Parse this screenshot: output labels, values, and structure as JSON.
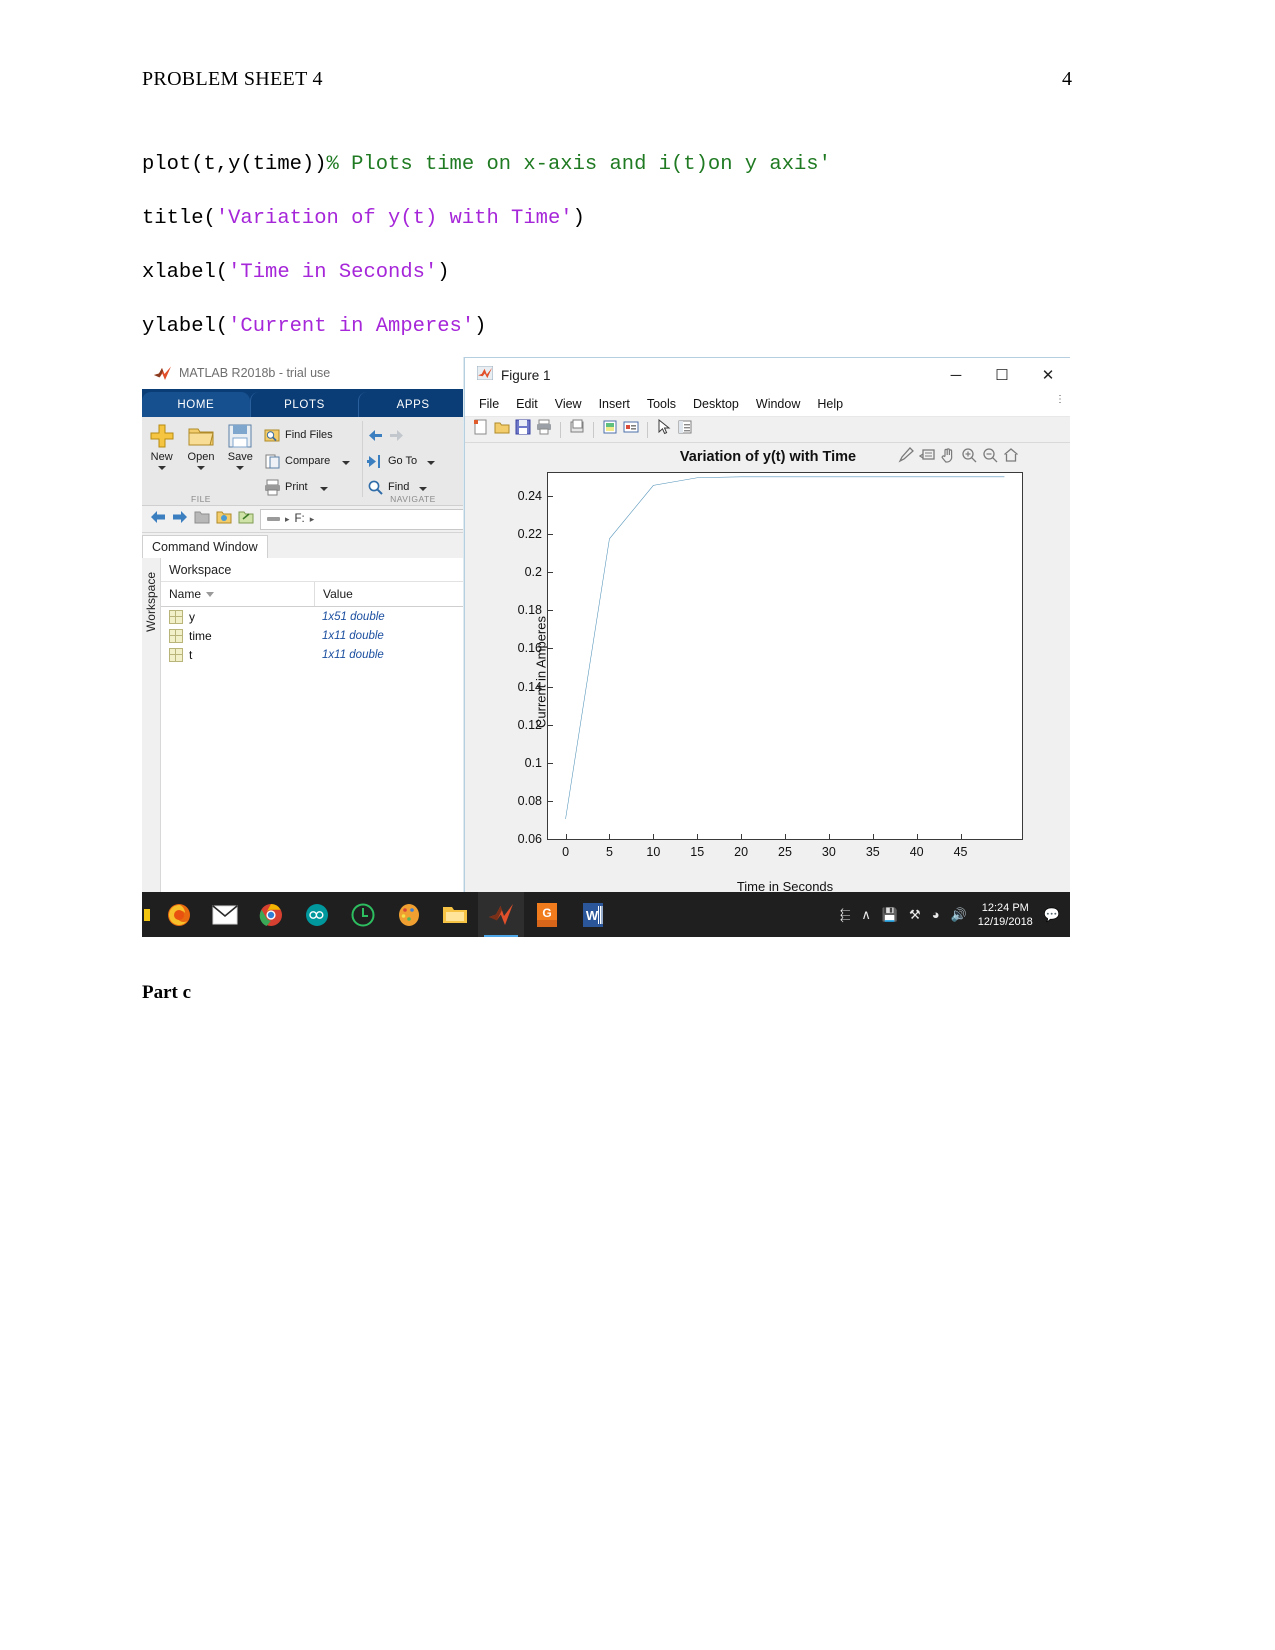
{
  "document": {
    "header_title": "PROBLEM SHEET 4",
    "page_number": "4",
    "part_label": "Part c"
  },
  "code_lines": [
    {
      "plain": "plot(t,y(time))",
      "comment": "% Plots time on x-axis and i(t)on y axis'"
    },
    {
      "plain": "title(",
      "string": "'Variation of y(t) with Time'",
      "tail": ")"
    },
    {
      "plain": "xlabel(",
      "string": "'Time in Seconds'",
      "tail": ")"
    },
    {
      "plain": "ylabel(",
      "string": "'Current in Amperes'",
      "tail": ")"
    }
  ],
  "matlab_window": {
    "title": "MATLAB R2018b - trial use",
    "ribbon_tabs": [
      "HOME",
      "PLOTS",
      "APPS"
    ],
    "file_group": {
      "label": "FILE",
      "buttons": [
        "New",
        "Open",
        "Save"
      ],
      "small_items": [
        "Find Files",
        "Compare",
        "Print"
      ]
    },
    "navigate_group": {
      "label": "NAVIGATE",
      "small_items": [
        "Go To",
        "Find"
      ]
    },
    "address_path": "F:",
    "command_window_tab": "Command Window",
    "workspace": {
      "side_label": "Workspace",
      "panel_title": "Workspace",
      "columns": [
        "Name",
        "Value"
      ],
      "rows": [
        {
          "name": "y",
          "value": "1x51 double"
        },
        {
          "name": "time",
          "value": "1x11 double"
        },
        {
          "name": "t",
          "value": "1x11 double"
        }
      ]
    }
  },
  "figure_window": {
    "title": "Figure 1",
    "window_buttons": [
      "minimize-button",
      "maximize-button",
      "close-button"
    ],
    "window_button_glyphs": [
      "─",
      "☐",
      "✕"
    ],
    "menu_items": [
      "File",
      "Edit",
      "View",
      "Insert",
      "Tools",
      "Desktop",
      "Window",
      "Help"
    ],
    "toolbar_icons": [
      "new-figure-icon",
      "open-file-icon",
      "save-figure-icon",
      "print-figure-icon",
      "print-preview-icon",
      "colorbar-icon",
      "legend-icon",
      "pointer-icon",
      "property-inspector-icon"
    ],
    "axes_toolbar_icons": [
      "brush-icon",
      "data-tips-icon",
      "pan-icon",
      "zoom-in-icon",
      "zoom-out-icon",
      "restore-view-icon"
    ]
  },
  "chart_data": {
    "type": "line",
    "title": "Variation of y(t) with Time",
    "xlabel": "Time in Seconds",
    "ylabel": "Current in Amperes",
    "xlim": [
      -2,
      52
    ],
    "ylim": [
      0.06,
      0.252
    ],
    "xticks": [
      0,
      5,
      10,
      15,
      20,
      25,
      30,
      35,
      40,
      45
    ],
    "xtick_labels": [
      "0",
      "5",
      "10",
      "15",
      "20",
      "25",
      "30",
      "35",
      "40",
      "45"
    ],
    "yticks": [
      0.06,
      0.08,
      0.1,
      0.12,
      0.14,
      0.16,
      0.18,
      0.2,
      0.22,
      0.24
    ],
    "ytick_labels": [
      "0.06",
      "0.08",
      "0.1",
      "0.12",
      "0.14",
      "0.16",
      "0.18",
      "0.2",
      "0.22",
      "0.24"
    ],
    "grid": false,
    "legend": null,
    "line_color": "#4f91b8",
    "series": [
      {
        "name": "y(time)",
        "x": [
          0,
          5,
          10,
          15,
          20,
          25,
          30,
          35,
          40,
          45,
          50
        ],
        "y": [
          0.0705,
          0.2175,
          0.2455,
          0.2495,
          0.25,
          0.25,
          0.25,
          0.25,
          0.25,
          0.25,
          0.25
        ]
      }
    ]
  },
  "taskbar": {
    "items": [
      {
        "name": "firefox-icon",
        "color": "#e8690f"
      },
      {
        "name": "mail-icon",
        "color": "#ffffff"
      },
      {
        "name": "chrome-icon",
        "color": "#d64030"
      },
      {
        "name": "arduino-icon",
        "color": "#00979d"
      },
      {
        "name": "ubuntu-icon",
        "color": "#2dbe60"
      },
      {
        "name": "paint-icon",
        "color": "#f0a030"
      },
      {
        "name": "file-explorer-icon",
        "color": "#f6c344"
      },
      {
        "name": "matlab-icon",
        "color": "#e1502a"
      },
      {
        "name": "pdf-tool-icon",
        "color": "#f07c1e"
      },
      {
        "name": "word-icon",
        "color": "#2b579a"
      }
    ],
    "tray": [
      "people-icon",
      "show-hidden-icons-icon",
      "safely-remove-icon",
      "input-language-icon",
      "network-icon",
      "volume-muted-icon"
    ],
    "clock_time": "12:24 PM",
    "clock_date": "12/19/2018",
    "action_center": "notification-icon"
  }
}
